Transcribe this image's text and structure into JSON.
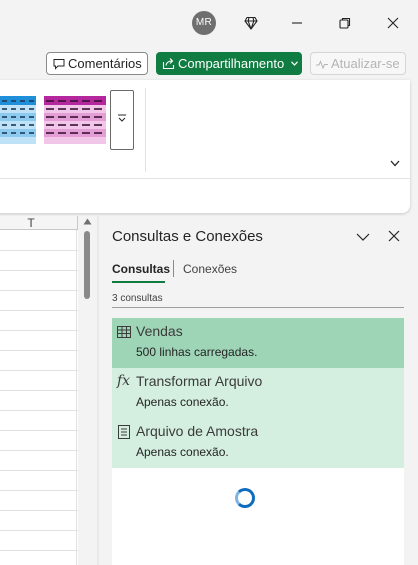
{
  "titlebar": {
    "avatar_initials": "MR",
    "icons": [
      "diamond-icon",
      "minimize-icon",
      "restore-icon",
      "close-icon"
    ]
  },
  "actions": {
    "comments_label": "Comentários",
    "share_label": "Compartilhamento",
    "refresh_label": "Atualizar-se"
  },
  "colors": {
    "brand_green": "#107c41",
    "selected_item": "#9fd5b7",
    "item_highlight": "#d4efdf",
    "swatch_blue": "#1e8fd8",
    "swatch_pink": "#c24fb0",
    "spinner_blue": "#0f6cbd"
  },
  "sheet": {
    "column_header": "T"
  },
  "pane": {
    "title": "Consultas e Conexões",
    "tabs": [
      {
        "label": "Consultas",
        "active": true
      },
      {
        "label": "Conexões",
        "active": false
      }
    ],
    "count_text": "3 consultas",
    "queries": [
      {
        "name": "Vendas",
        "status": "500 linhas carregadas.",
        "icon": "table-icon",
        "selected": true
      },
      {
        "name": "Transformar Arquivo",
        "status": "Apenas conexão.",
        "icon": "function-fx-icon",
        "selected": false
      },
      {
        "name": "Arquivo de Amostra",
        "status": "Apenas conexão.",
        "icon": "document-icon",
        "selected": false
      }
    ]
  }
}
